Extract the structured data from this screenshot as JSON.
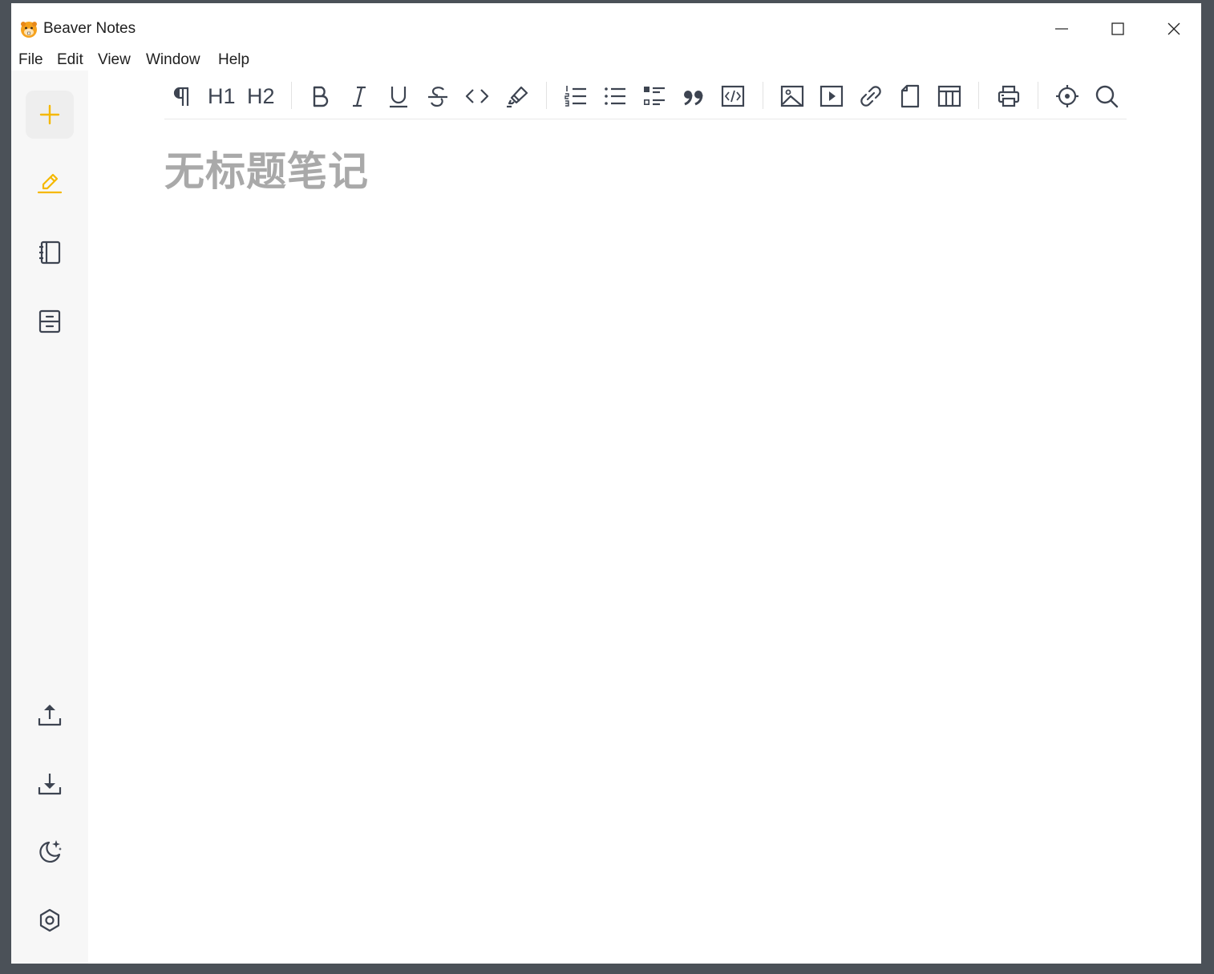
{
  "window": {
    "title": "Beaver Notes",
    "controls": [
      "minimize",
      "maximize",
      "close"
    ]
  },
  "menubar": {
    "items": [
      {
        "label": "File"
      },
      {
        "label": "Edit"
      },
      {
        "label": "View"
      },
      {
        "label": "Window"
      },
      {
        "label": "Help"
      }
    ]
  },
  "sidebar": {
    "top": [
      {
        "icon": "plus-icon",
        "tooltip": "new-note"
      },
      {
        "icon": "pencil-icon",
        "active": true
      },
      {
        "icon": "notebook-icon"
      },
      {
        "icon": "archive-icon"
      }
    ],
    "bottom": [
      {
        "icon": "upload-icon"
      },
      {
        "icon": "download-icon"
      },
      {
        "icon": "moon-sparkle-icon"
      },
      {
        "icon": "settings-hexagon-icon"
      }
    ]
  },
  "toolbar": {
    "groups": [
      [
        "paragraph-icon",
        "h1",
        "h2"
      ],
      [
        "bold-icon",
        "italic-icon",
        "underline-icon",
        "strikethrough-icon",
        "code-icon",
        "highlighter-icon"
      ],
      [
        "ordered-list-icon",
        "bullet-list-icon",
        "task-list-icon",
        "quote-icon",
        "code-block-icon"
      ],
      [
        "image-icon",
        "video-icon",
        "link-icon",
        "file-icon",
        "table-icon"
      ],
      [
        "print-icon"
      ],
      [
        "locate-icon",
        "search-icon"
      ]
    ],
    "h1_label": "H1",
    "h2_label": "H2"
  },
  "editor": {
    "title_placeholder": "无标题笔记"
  },
  "colors": {
    "accent": "#f5b800",
    "icon": "#3d4451",
    "frame": "#4b5158",
    "placeholder": "#a9a9a9"
  }
}
